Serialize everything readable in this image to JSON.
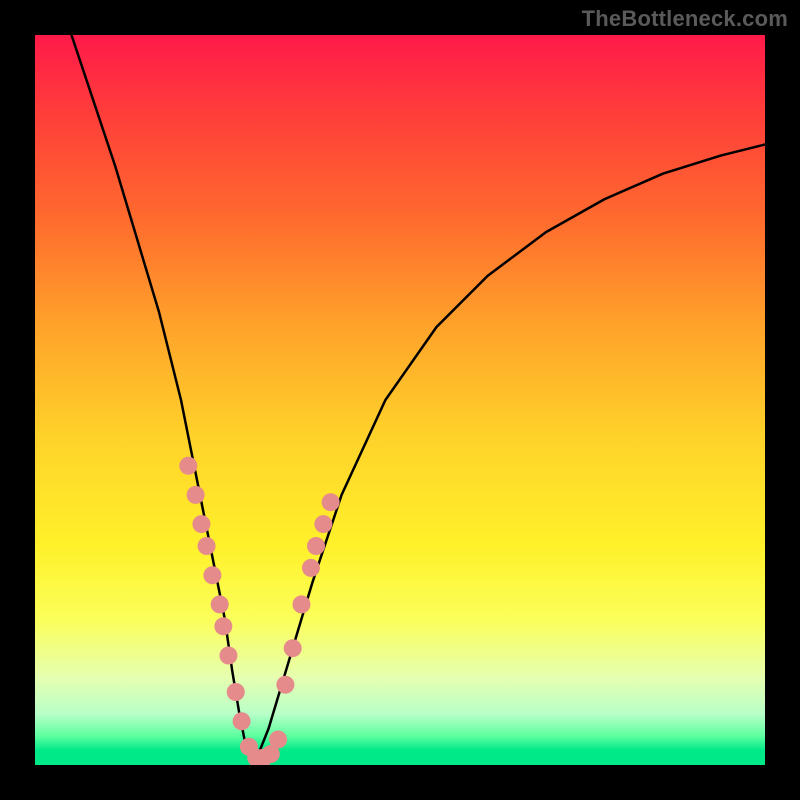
{
  "watermark": "TheBottleneck.com",
  "chart_data": {
    "type": "line",
    "title": "",
    "xlabel": "",
    "ylabel": "",
    "xlim": [
      0,
      100
    ],
    "ylim": [
      0,
      100
    ],
    "background_gradient": {
      "top": "#ff1a49",
      "bottom": "#00e989",
      "meaning": "top = high bottleneck (red), bottom = low bottleneck (green)"
    },
    "series": [
      {
        "name": "bottleneck-curve-left",
        "color": "#000000",
        "x": [
          5,
          8,
          11,
          14,
          17,
          20,
          22,
          24,
          26,
          27,
          28,
          29,
          30
        ],
        "y": [
          100,
          91,
          82,
          72,
          62,
          50,
          40,
          30,
          20,
          13,
          7,
          2,
          0
        ]
      },
      {
        "name": "bottleneck-curve-right",
        "color": "#000000",
        "x": [
          30,
          32,
          35,
          38,
          42,
          48,
          55,
          62,
          70,
          78,
          86,
          94,
          100
        ],
        "y": [
          0,
          5,
          15,
          25,
          37,
          50,
          60,
          67,
          73,
          77.5,
          81,
          83.5,
          85
        ]
      }
    ],
    "scatter": {
      "name": "data-points",
      "color": "#e58b8b",
      "radius_px": 9,
      "points": [
        {
          "x": 21,
          "y": 41
        },
        {
          "x": 22,
          "y": 37
        },
        {
          "x": 22.8,
          "y": 33
        },
        {
          "x": 23.5,
          "y": 30
        },
        {
          "x": 24.3,
          "y": 26
        },
        {
          "x": 25.3,
          "y": 22
        },
        {
          "x": 25.8,
          "y": 19
        },
        {
          "x": 26.5,
          "y": 15
        },
        {
          "x": 27.5,
          "y": 10
        },
        {
          "x": 28.3,
          "y": 6
        },
        {
          "x": 29.3,
          "y": 2.5
        },
        {
          "x": 30.3,
          "y": 1
        },
        {
          "x": 31.3,
          "y": 1
        },
        {
          "x": 32.3,
          "y": 1.5
        },
        {
          "x": 33.3,
          "y": 3.5
        },
        {
          "x": 34.3,
          "y": 11
        },
        {
          "x": 35.3,
          "y": 16
        },
        {
          "x": 36.5,
          "y": 22
        },
        {
          "x": 37.8,
          "y": 27
        },
        {
          "x": 38.5,
          "y": 30
        },
        {
          "x": 39.5,
          "y": 33
        },
        {
          "x": 40.5,
          "y": 36
        }
      ]
    }
  }
}
